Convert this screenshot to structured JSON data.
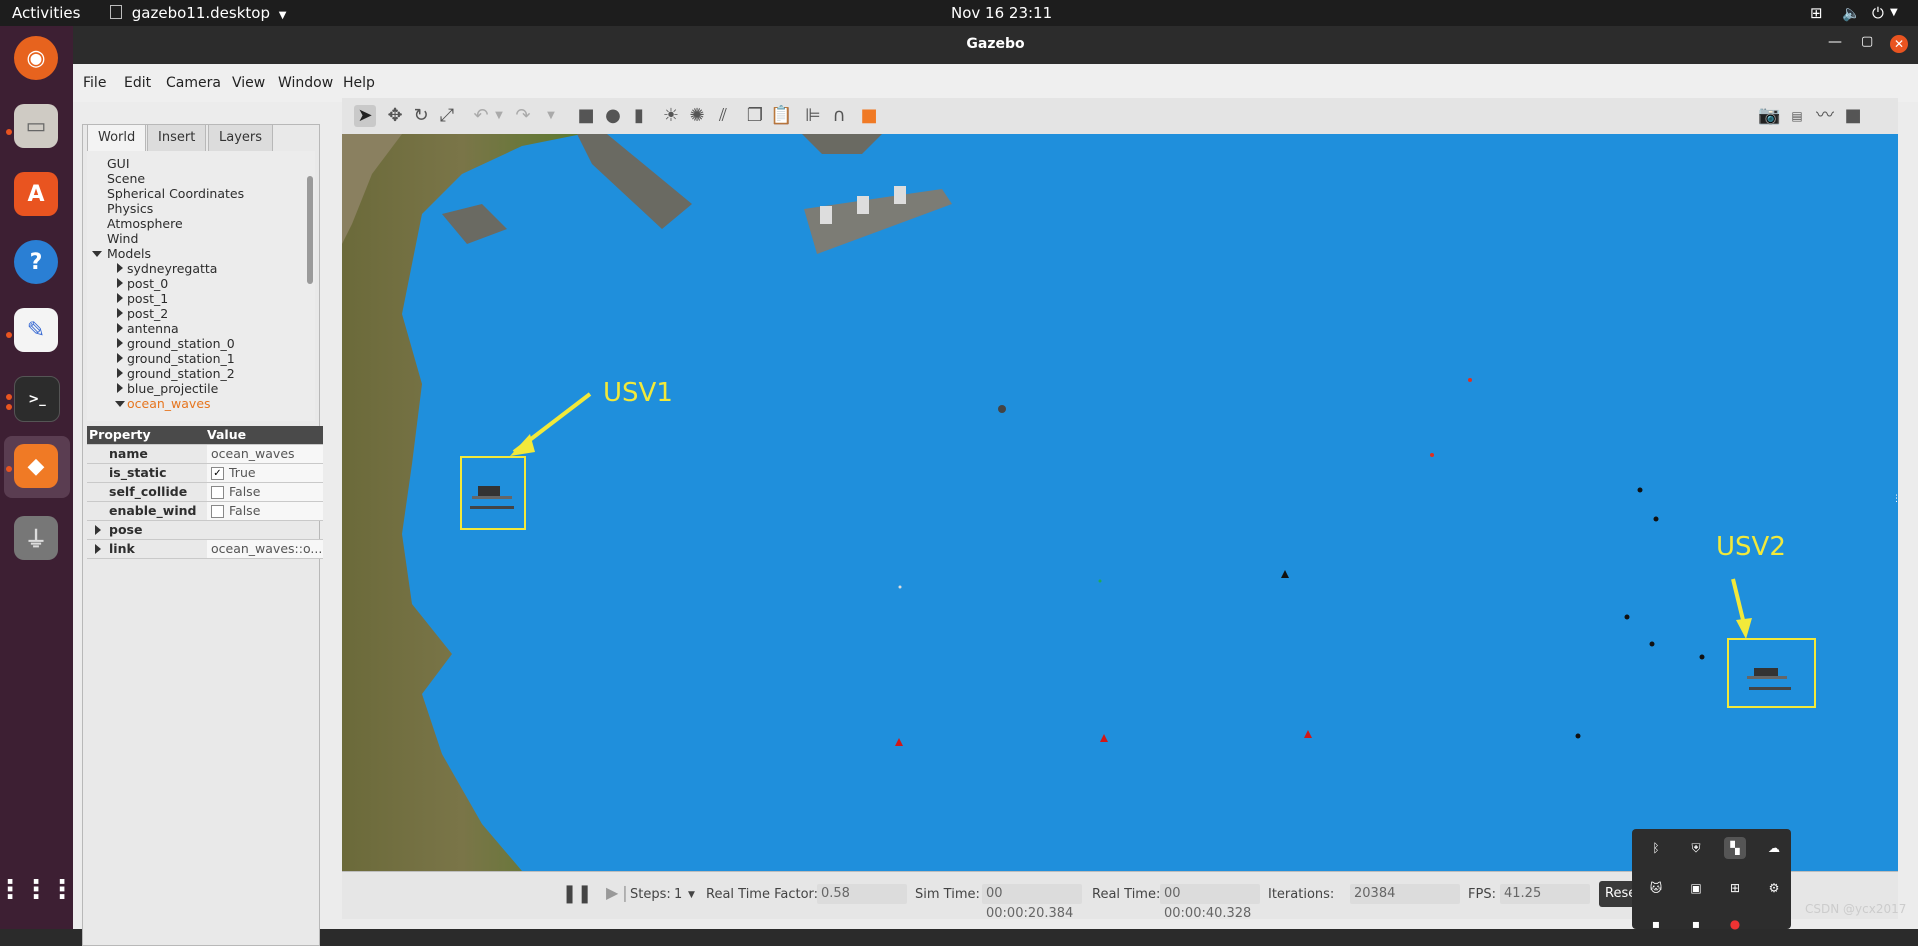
{
  "topbar": {
    "activities": "Activities",
    "app_name": "gazebo11.desktop",
    "datetime": "Nov 16  23:11"
  },
  "window": {
    "title": "Gazebo"
  },
  "menu": [
    "File",
    "Edit",
    "Camera",
    "View",
    "Window",
    "Help"
  ],
  "left_panel": {
    "tabs": [
      "World",
      "Insert",
      "Layers"
    ],
    "tree_top": [
      "GUI",
      "Scene",
      "Spherical Coordinates",
      "Physics",
      "Atmosphere",
      "Wind"
    ],
    "models_label": "Models",
    "models": [
      "sydneyregatta",
      "post_0",
      "post_1",
      "post_2",
      "antenna",
      "ground_station_0",
      "ground_station_1",
      "ground_station_2",
      "blue_projectile",
      "ocean_waves"
    ],
    "selected_model": "ocean_waves",
    "property_header": "Property",
    "value_header": "Value",
    "properties": [
      {
        "name": "name",
        "value": "ocean_waves"
      },
      {
        "name": "is_static",
        "value": "True",
        "checked": true
      },
      {
        "name": "self_collide",
        "value": "False",
        "checked": false
      },
      {
        "name": "enable_wind",
        "value": "False",
        "checked": false
      },
      {
        "name": "pose",
        "value": ""
      },
      {
        "name": "link",
        "value": "ocean_waves::o..."
      }
    ]
  },
  "viewport": {
    "usv1_label": "USV1",
    "usv2_label": "USV2",
    "water_color": "#1d8ad6",
    "annotation_color": "#f2e93a"
  },
  "bottom": {
    "steps_label": "Steps:",
    "steps_value": "1",
    "rtf_label": "Real Time Factor:",
    "rtf_value": "0.58",
    "sim_time_label": "Sim Time:",
    "sim_time_value": "00 00:00:20.384",
    "real_time_label": "Real Time:",
    "real_time_value": "00 00:00:40.328",
    "iterations_label": "Iterations:",
    "iterations_value": "20384",
    "fps_label": "FPS:",
    "fps_value": "41.25",
    "reset_label": "Rese"
  },
  "watermark": "CSDN @ycx2017"
}
